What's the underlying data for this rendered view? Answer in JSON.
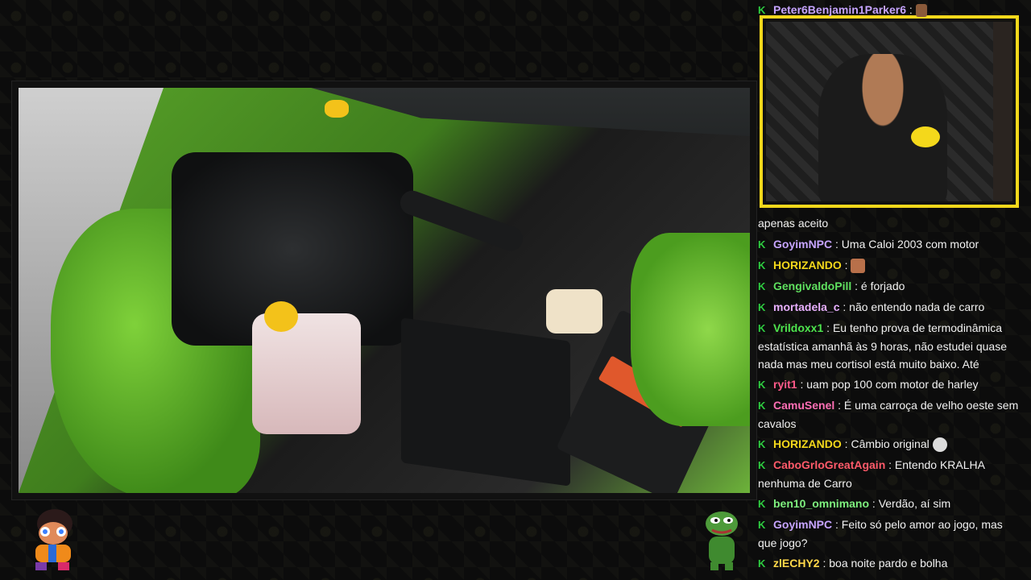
{
  "colors": {
    "badge": "#2ecc40",
    "webcam_border": "#f4d81b",
    "message": "#f1f1f1"
  },
  "chat": {
    "messages": [
      {
        "user": "Peter6Benjamin1Parker6",
        "user_color": "#c6a4ff",
        "text": "",
        "emote": "small-character-emote"
      },
      {
        "user": "",
        "user_color": "#ffffff",
        "text": "apenas aceito"
      },
      {
        "user": "GoyimNPC",
        "user_color": "#c6a4ff",
        "text": "Uma Caloi 2003 com motor"
      },
      {
        "user": "HORIZANDO",
        "user_color": "#f4d81b",
        "text": "",
        "emote": "pixel-face-emote"
      },
      {
        "user": "GengivaldoPill",
        "user_color": "#5fe05f",
        "text": "é forjado"
      },
      {
        "user": "mortadela_c",
        "user_color": "#e8b0ff",
        "text": "não entendo nada de carro"
      },
      {
        "user": "Vrildoxx1",
        "user_color": "#4de34d",
        "text": "Eu tenho prova de termodinâmica estatística amanhã às 9 horas, não estudei quase nada mas meu cortisol está muito baixo. Até"
      },
      {
        "user": "ryit1",
        "user_color": "#ff5a8a",
        "text": "uam pop 100 com motor de harley"
      },
      {
        "user": "CamuSenel",
        "user_color": "#ff6fb5",
        "text": "É uma carroça de velho oeste sem cavalos"
      },
      {
        "user": "HORIZANDO",
        "user_color": "#f4d81b",
        "text": "Câmbio original",
        "emote": "speech-bubble-emote"
      },
      {
        "user": "CaboGrloGreatAgain",
        "user_color": "#ff5a6a",
        "text": "Entendo KRALHA nenhuma de Carro"
      },
      {
        "user": "ben10_omnimano",
        "user_color": "#7ef07e",
        "text": "Verdão, aí sim"
      },
      {
        "user": "GoyimNPC",
        "user_color": "#c6a4ff",
        "text": "Feito só pelo amor ao jogo, mas que jogo?"
      },
      {
        "user": "zlECHY2",
        "user_color": "#ffd84a",
        "text": "boa noite pardo e bolha"
      }
    ]
  },
  "icons": {
    "badge": "verified-k-badge-icon",
    "sticker_left": "cartoon-character-sticker",
    "sticker_right": "pepe-frog-sticker"
  }
}
